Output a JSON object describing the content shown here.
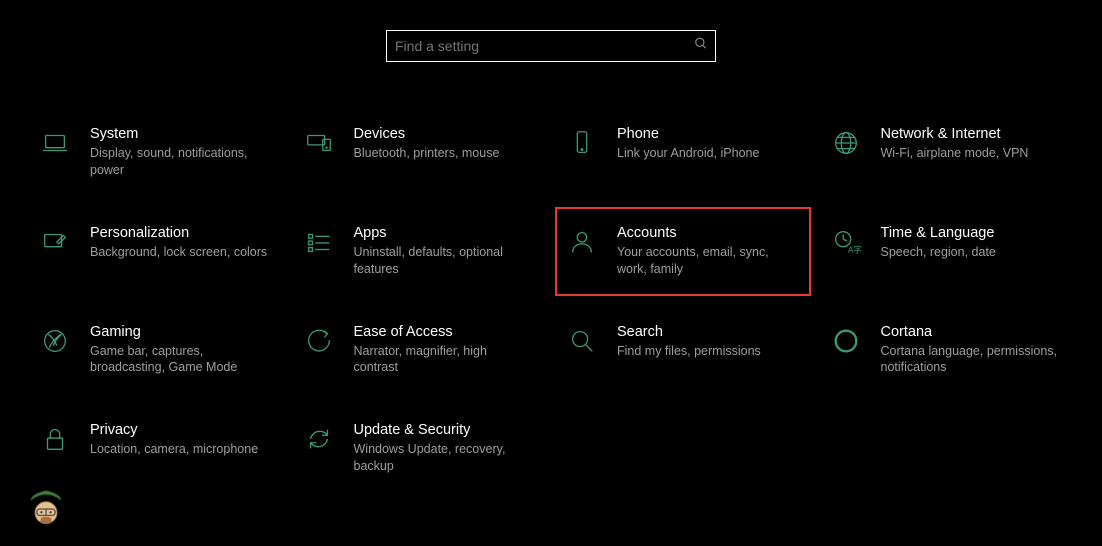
{
  "search": {
    "placeholder": "Find a setting"
  },
  "tiles": {
    "system": {
      "title": "System",
      "desc": "Display, sound, notifications, power"
    },
    "devices": {
      "title": "Devices",
      "desc": "Bluetooth, printers, mouse"
    },
    "phone": {
      "title": "Phone",
      "desc": "Link your Android, iPhone"
    },
    "network": {
      "title": "Network & Internet",
      "desc": "Wi-Fi, airplane mode, VPN"
    },
    "personal": {
      "title": "Personalization",
      "desc": "Background, lock screen, colors"
    },
    "apps": {
      "title": "Apps",
      "desc": "Uninstall, defaults, optional features"
    },
    "accounts": {
      "title": "Accounts",
      "desc": "Your accounts, email, sync, work, family"
    },
    "timelang": {
      "title": "Time & Language",
      "desc": "Speech, region, date"
    },
    "gaming": {
      "title": "Gaming",
      "desc": "Game bar, captures, broadcasting, Game Mode"
    },
    "ease": {
      "title": "Ease of Access",
      "desc": "Narrator, magnifier, high contrast"
    },
    "searchcat": {
      "title": "Search",
      "desc": "Find my files, permissions"
    },
    "cortana": {
      "title": "Cortana",
      "desc": "Cortana language, permissions, notifications"
    },
    "privacy": {
      "title": "Privacy",
      "desc": "Location, camera, microphone"
    },
    "update": {
      "title": "Update & Security",
      "desc": "Windows Update, recovery, backup"
    }
  }
}
